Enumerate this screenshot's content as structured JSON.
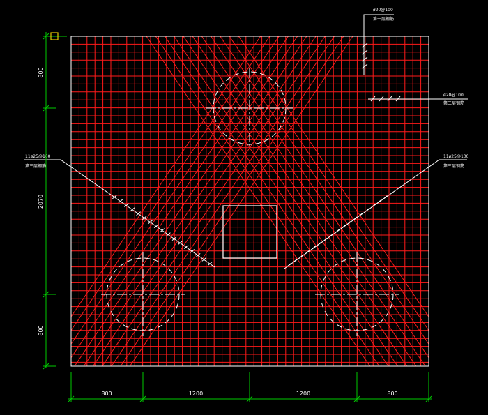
{
  "colors": {
    "background": "#000000",
    "rebar": "#ff1a1a",
    "outline": "#ffffff",
    "dimension": "#00cc00",
    "marker": "#e6c800"
  },
  "dimensions": {
    "bottom": [
      "800",
      "1200",
      "1200",
      "800"
    ],
    "left": [
      "800",
      "2070",
      "800"
    ]
  },
  "annotations": {
    "top_right": {
      "spec": "ø20@100",
      "note": "第一层钢筋"
    },
    "right": {
      "spec": "ø20@100",
      "note": "第二层钢筋"
    },
    "left": {
      "spec": "11ø25@100",
      "note": "第三层钢筋"
    },
    "mid_right": {
      "spec": "11ø25@100",
      "note": "第三层钢筋"
    }
  },
  "icons": {
    "corner_marker": "snap-square-icon",
    "pile": "dashed-circle-icon"
  }
}
